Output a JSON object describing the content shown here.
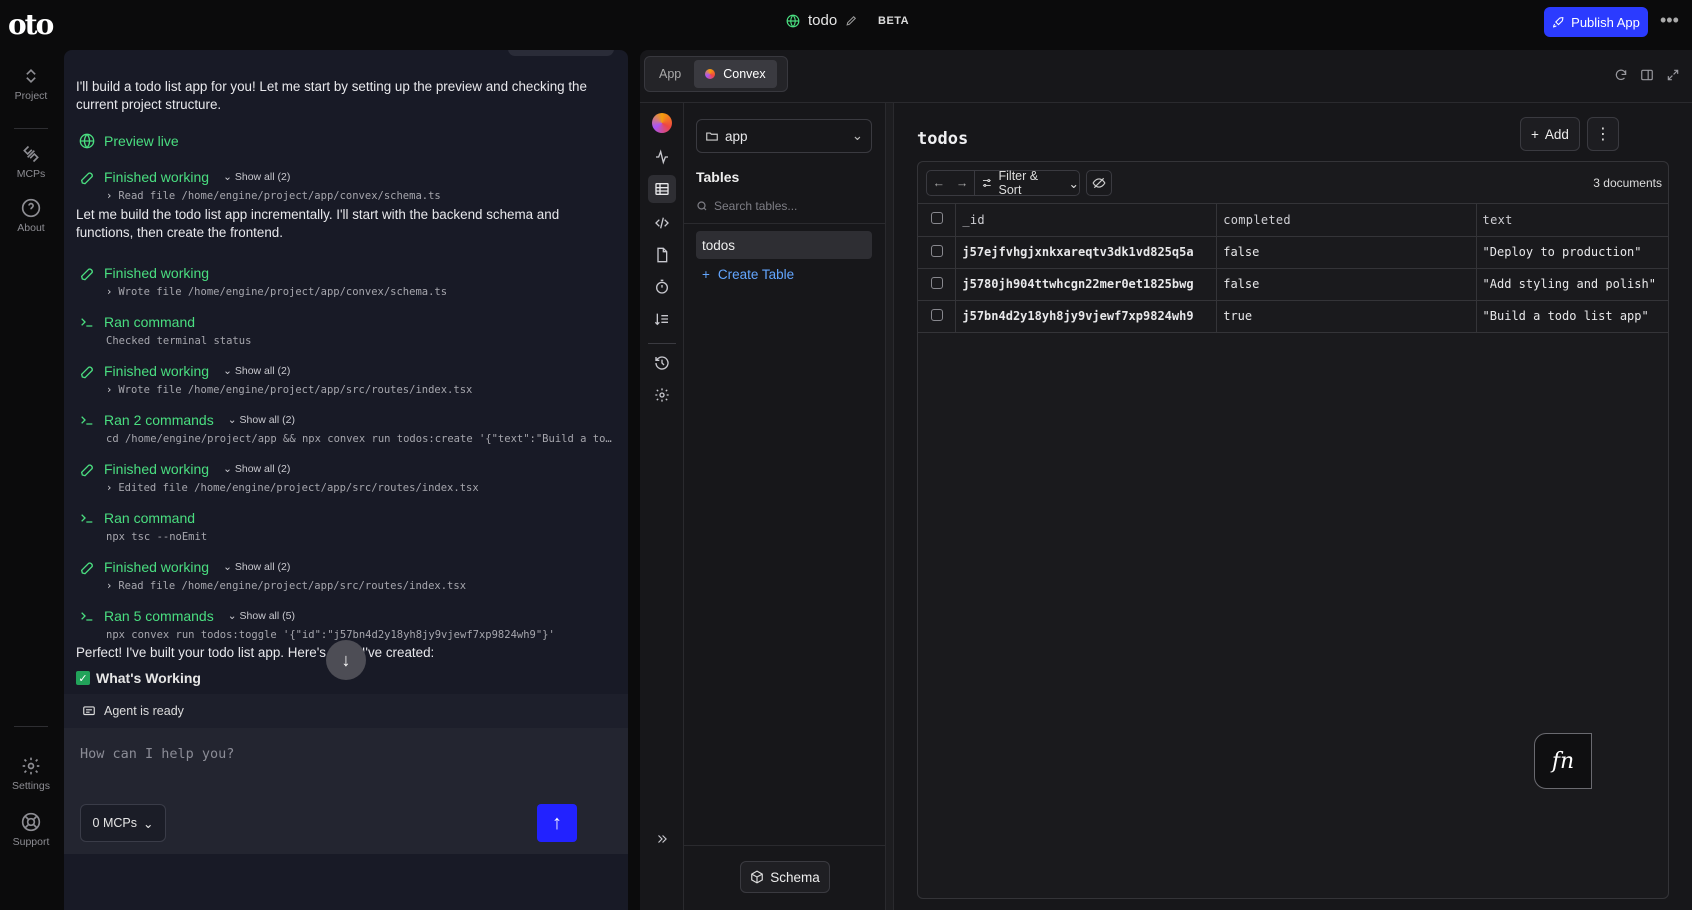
{
  "app": {
    "logo": "oto",
    "project_name": "todo",
    "beta_label": "BETA",
    "publish_label": "Publish App",
    "more": "•••"
  },
  "rail": {
    "items": [
      {
        "label": "Project",
        "icon": "chevrons-updown-icon"
      },
      {
        "label": "MCPs",
        "icon": "plug-icon"
      },
      {
        "label": "About",
        "icon": "help-circle-icon"
      }
    ],
    "bottom": [
      {
        "label": "Settings",
        "icon": "gear-icon"
      },
      {
        "label": "Support",
        "icon": "lifebuoy-icon"
      }
    ]
  },
  "chat": {
    "intro": "I'll build a todo list app for you! Let me start by setting up the preview and checking the current project structure.",
    "preview": "Preview live",
    "steps": [
      {
        "title": "Finished working",
        "show_all": "Show all (2)",
        "detail": "Read file /home/engine/project/app/convex/schema.ts",
        "icon": "wrench-icon"
      },
      {
        "title": "Finished working",
        "show_all": "",
        "detail": "Wrote file /home/engine/project/app/convex/schema.ts",
        "icon": "wrench-icon"
      },
      {
        "title": "Ran command",
        "show_all": "",
        "detail": "Checked terminal status",
        "icon": "terminal-icon"
      },
      {
        "title": "Finished working",
        "show_all": "Show all (2)",
        "detail": "Wrote file /home/engine/project/app/src/routes/index.tsx",
        "icon": "wrench-icon"
      },
      {
        "title": "Ran 2 commands",
        "show_all": "Show all (2)",
        "detail": "cd /home/engine/project/app && npx convex run todos:create '{\"text\":\"Build a todo list app\"}'",
        "icon": "terminal-icon"
      },
      {
        "title": "Finished working",
        "show_all": "Show all (2)",
        "detail": "Edited file /home/engine/project/app/src/routes/index.tsx",
        "icon": "wrench-icon"
      },
      {
        "title": "Ran command",
        "show_all": "",
        "detail": "npx tsc --noEmit",
        "icon": "terminal-icon"
      },
      {
        "title": "Finished working",
        "show_all": "Show all (2)",
        "detail": "Read file /home/engine/project/app/src/routes/index.tsx",
        "icon": "wrench-icon"
      },
      {
        "title": "Ran 5 commands",
        "show_all": "Show all (5)",
        "detail": "npx convex run todos:toggle '{\"id\":\"j57bn4d2y18yh8jy9vjewf7xp9824wh9\"}'",
        "icon": "terminal-icon"
      }
    ],
    "middle": "Let me build the todo list app incrementally. I'll start with the backend schema and functions, then create the frontend.",
    "perfect": "Perfect! I've built your todo list app. Here's what I've created:",
    "whats_working": "What's Working",
    "agent_status": "Agent is ready",
    "input_placeholder": "How can I help you?",
    "mcps_label": "0 MCPs"
  },
  "right": {
    "tabs": [
      {
        "label": "App",
        "active": false
      },
      {
        "label": "Convex",
        "active": true
      }
    ],
    "app_selector": "app",
    "tables_heading": "Tables",
    "search_placeholder": "Search tables...",
    "tables": [
      "todos"
    ],
    "create_table": "Create Table",
    "schema_label": "Schema",
    "table_title": "todos",
    "add_label": "Add",
    "filter_label": "Filter & Sort",
    "doc_count": "3 documents",
    "columns": [
      "_id",
      "completed",
      "text"
    ],
    "rows": [
      {
        "_id": "j57ejfvhgjxnkxareqtv3dk1vd825q5a",
        "completed": "false",
        "text": "\"Deploy to production\""
      },
      {
        "_id": "j5780jh904ttwhcgn22mer0et1825bwg",
        "completed": "false",
        "text": "\"Add styling and polish\""
      },
      {
        "_id": "j57bn4d2y18yh8jy9vjewf7xp9824wh9",
        "completed": "true",
        "text": "\"Build a todo list app\""
      }
    ],
    "fn_label": "fn"
  }
}
